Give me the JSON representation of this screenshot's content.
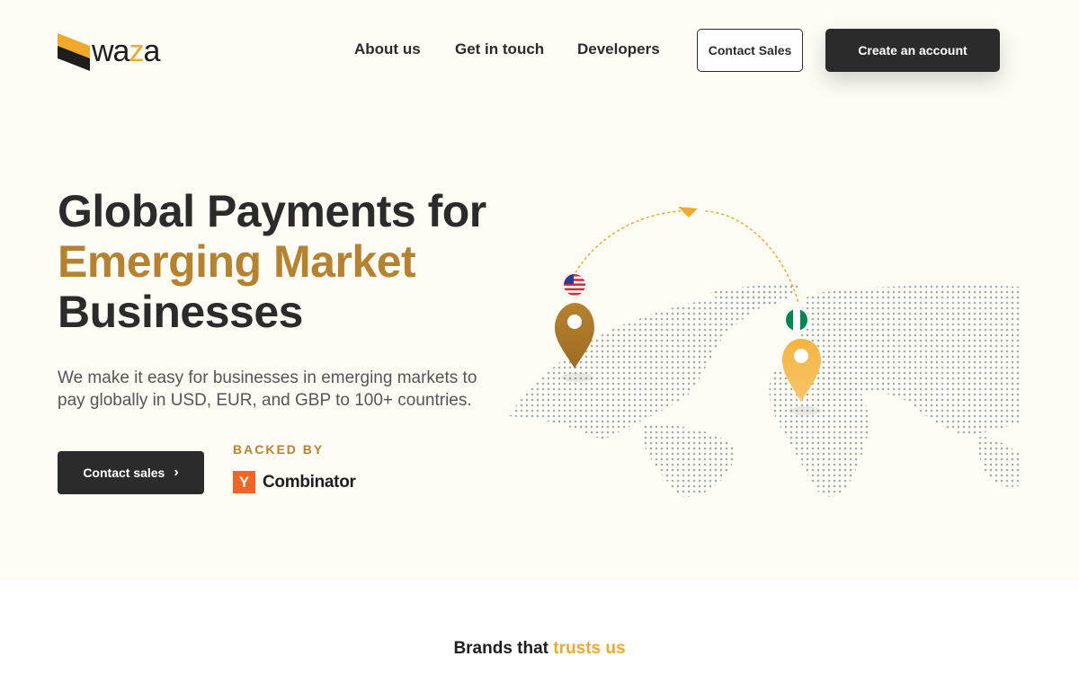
{
  "header": {
    "logo_text_prefix": "wa",
    "logo_text_accent": "z",
    "logo_text_suffix": "a",
    "nav": [
      {
        "label": "About us"
      },
      {
        "label": "Get in touch"
      },
      {
        "label": "Developers"
      }
    ],
    "contact_sales_label": "Contact Sales",
    "create_account_label": "Create an account"
  },
  "hero": {
    "headline_line1": "Global Payments for",
    "headline_line2": "Emerging Market",
    "headline_line3": "Businesses",
    "subtext": "We make it easy for businesses in emerging markets to pay globally in USD, EUR, and GBP to 100+ countries.",
    "cta_label": "Contact sales",
    "backed_by_label": "BACKED BY",
    "backer_letter": "Y",
    "backer_name": "Combinator"
  },
  "brands": {
    "prefix": "Brands that",
    "accent": "trusts us"
  },
  "colors": {
    "accent_gold": "#b7822f",
    "accent_orange": "#f0a92a",
    "dark": "#2b2b2b",
    "hero_bg": "#fdfdf6"
  }
}
